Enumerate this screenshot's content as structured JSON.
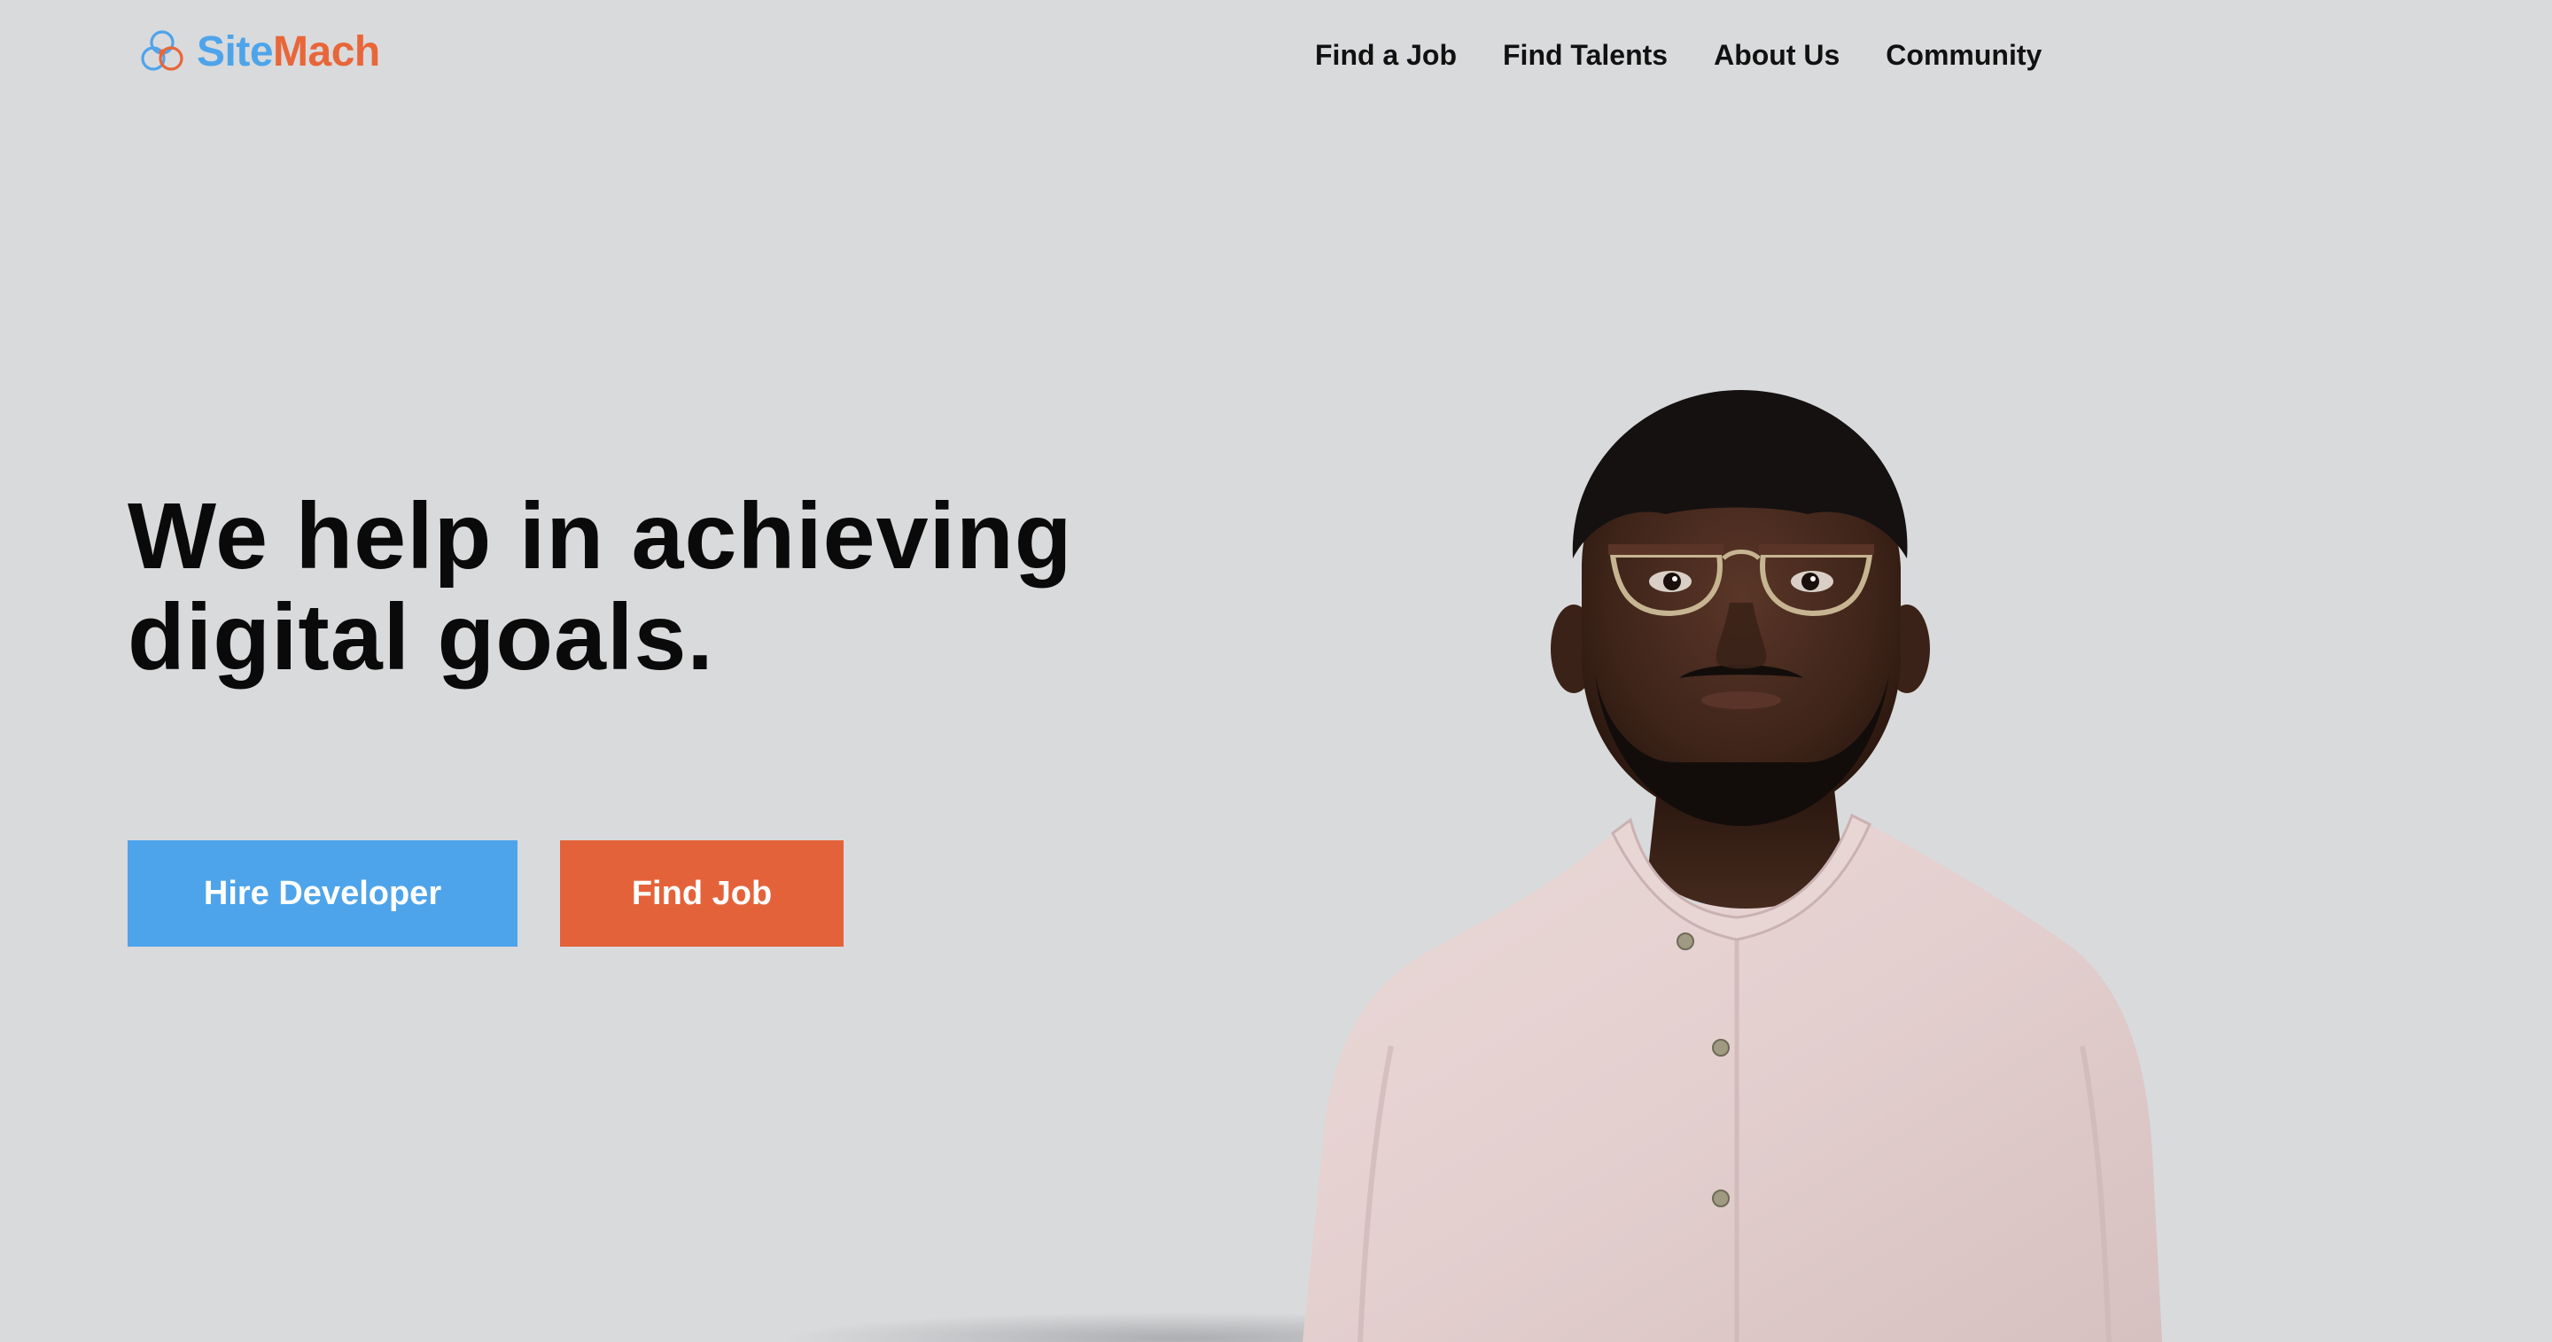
{
  "header": {
    "logo": {
      "name_part1": "Site",
      "name_part2": "Mach",
      "icon": "trefoil-logo-icon"
    },
    "nav": [
      {
        "label": "Find a Job"
      },
      {
        "label": "Find Talents"
      },
      {
        "label": "About Us"
      },
      {
        "label": "Community"
      }
    ]
  },
  "hero": {
    "headline_line1": "We help in achieving",
    "headline_line2": "digital goals.",
    "primary_button": "Hire Developer",
    "secondary_button": "Find Job",
    "image": "portrait-photo"
  },
  "colors": {
    "brand_blue": "#4ea4ea",
    "brand_orange": "#e4623a",
    "background": "#d9dadc",
    "text": "#0a0a0a"
  }
}
